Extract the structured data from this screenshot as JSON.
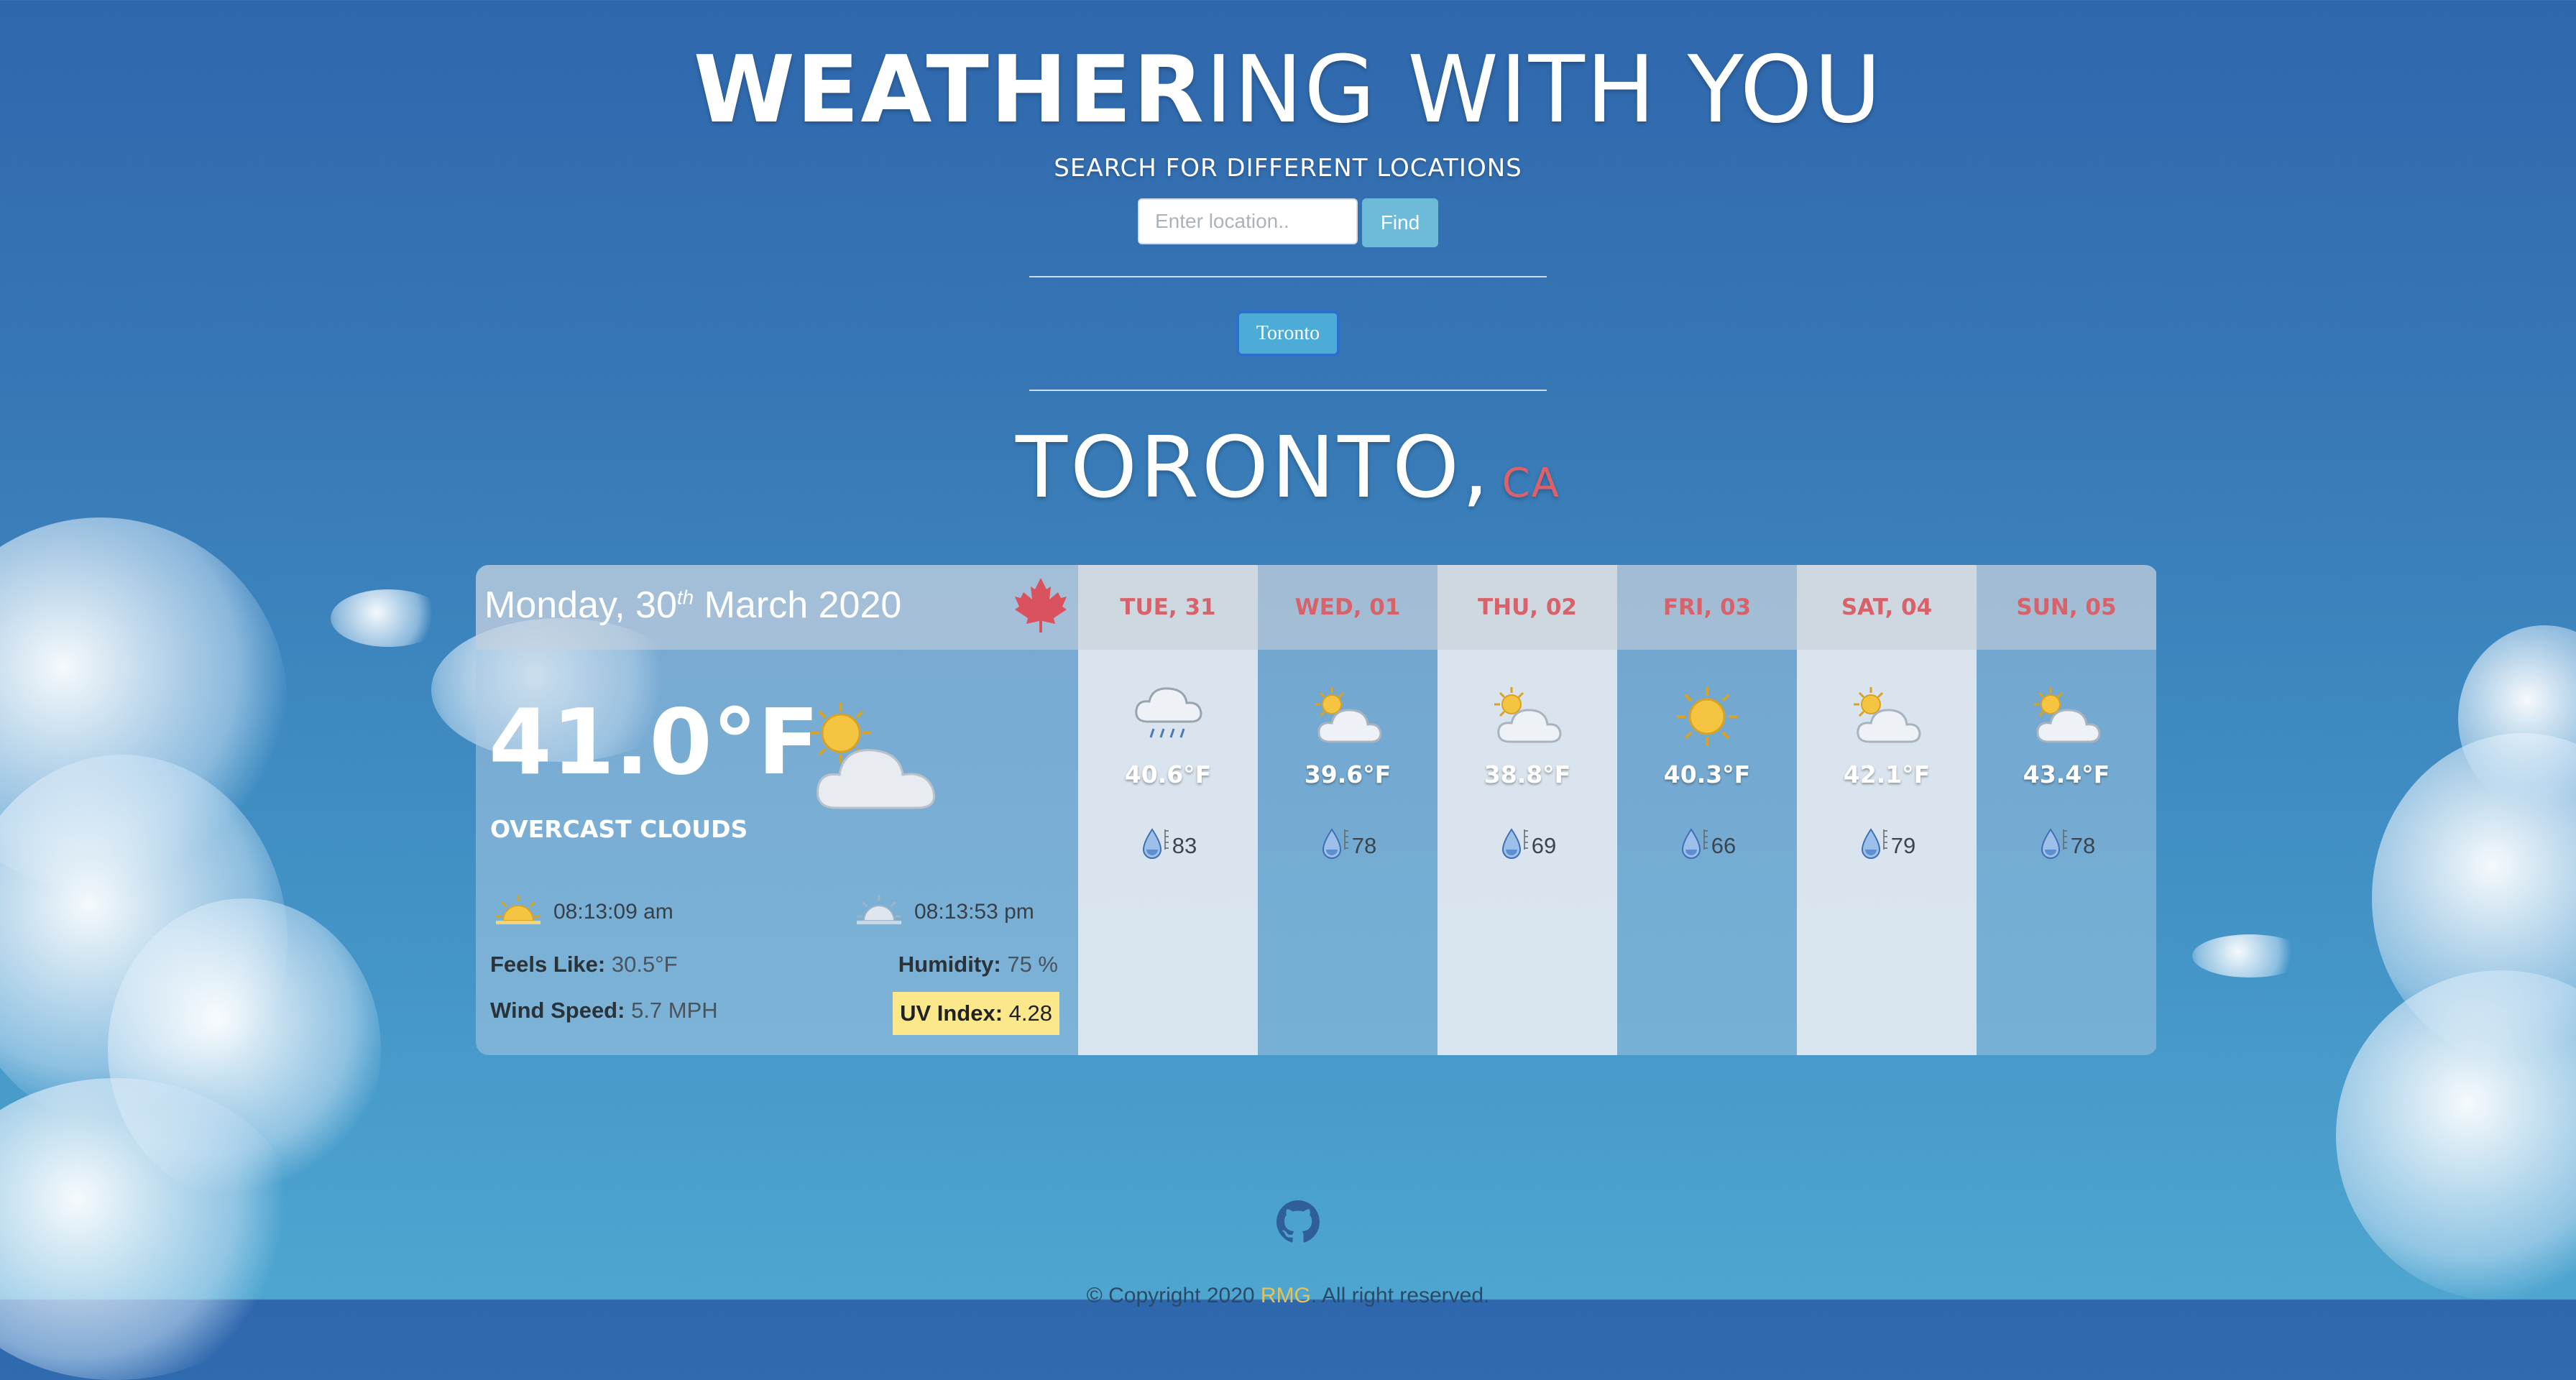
{
  "header": {
    "title_bold": "WEATHER",
    "title_light": "ING WITH YOU",
    "subtitle": "SEARCH FOR DIFFERENT LOCATIONS",
    "search_placeholder": "Enter location..",
    "find_label": "Find"
  },
  "saved_locations": [
    {
      "label": "Toronto"
    }
  ],
  "location": {
    "city": "TORONTO,",
    "country": "CA"
  },
  "today": {
    "day": "Monday, 30",
    "sup": "th",
    "month_year": " March 2020",
    "temperature": "41.0°F",
    "condition": "OVERCAST CLOUDS",
    "sunrise": "08:13:09 am",
    "sunset": "08:13:53 pm",
    "feels_like_label": "Feels Like:",
    "feels_like": "30.5°F",
    "humidity_label": "Humidity:",
    "humidity": "75 %",
    "wind_label": "Wind Speed:",
    "wind": "5.7 MPH",
    "uv_label": "UV Index:",
    "uv": "4.28",
    "icon": "partly-cloudy-icon"
  },
  "forecast": [
    {
      "day": "TUE, 31",
      "temp": "40.6°F",
      "humidity": "83",
      "icon": "rain-icon"
    },
    {
      "day": "WED, 01",
      "temp": "39.6°F",
      "humidity": "78",
      "icon": "partly-cloudy-icon"
    },
    {
      "day": "THU, 02",
      "temp": "38.8°F",
      "humidity": "69",
      "icon": "partly-cloudy-icon"
    },
    {
      "day": "FRI, 03",
      "temp": "40.3°F",
      "humidity": "66",
      "icon": "sun-icon"
    },
    {
      "day": "SAT, 04",
      "temp": "42.1°F",
      "humidity": "79",
      "icon": "partly-cloudy-icon"
    },
    {
      "day": "SUN, 05",
      "temp": "43.4°F",
      "humidity": "78",
      "icon": "partly-cloudy-icon"
    }
  ],
  "footer": {
    "prefix": "© Copyright 2020 ",
    "author": "RMG",
    "suffix": ". All right reserved."
  },
  "colors": {
    "accent_red": "#d9626a",
    "button_blue": "#4dabd8",
    "uv_yellow": "#fbe88a"
  }
}
